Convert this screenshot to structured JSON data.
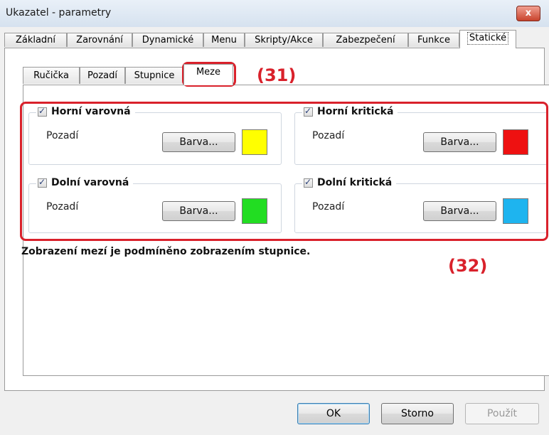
{
  "window": {
    "title": "Ukazatel - parametry",
    "close_symbol": "x"
  },
  "tabs": [
    "Základní",
    "Zarovnání",
    "Dynamické",
    "Menu",
    "Skripty/Akce",
    "Zabezpečení",
    "Funkce",
    "Statické"
  ],
  "active_tab": "Statické",
  "subtabs": [
    "Ručička",
    "Pozadí",
    "Stupnice",
    "Meze"
  ],
  "active_subtab": "Meze",
  "annotations": {
    "label_31": "(31)",
    "label_32": "(32)"
  },
  "groups": [
    {
      "title": "Horní varovná",
      "checked": true,
      "label": "Pozadí",
      "button": "Barva...",
      "color": "#ffff00"
    },
    {
      "title": "Horní kritická",
      "checked": true,
      "label": "Pozadí",
      "button": "Barva...",
      "color": "#ee1111"
    },
    {
      "title": "Dolní varovná",
      "checked": true,
      "label": "Pozadí",
      "button": "Barva...",
      "color": "#22dd22"
    },
    {
      "title": "Dolní kritická",
      "checked": true,
      "label": "Pozadí",
      "button": "Barva...",
      "color": "#1eb4ef"
    }
  ],
  "note": "Zobrazení mezí je podmíněno zobrazením stupnice.",
  "buttons": {
    "ok": "OK",
    "cancel": "Storno",
    "apply": "Použít"
  },
  "colors": {
    "annotation": "#d9212b"
  }
}
